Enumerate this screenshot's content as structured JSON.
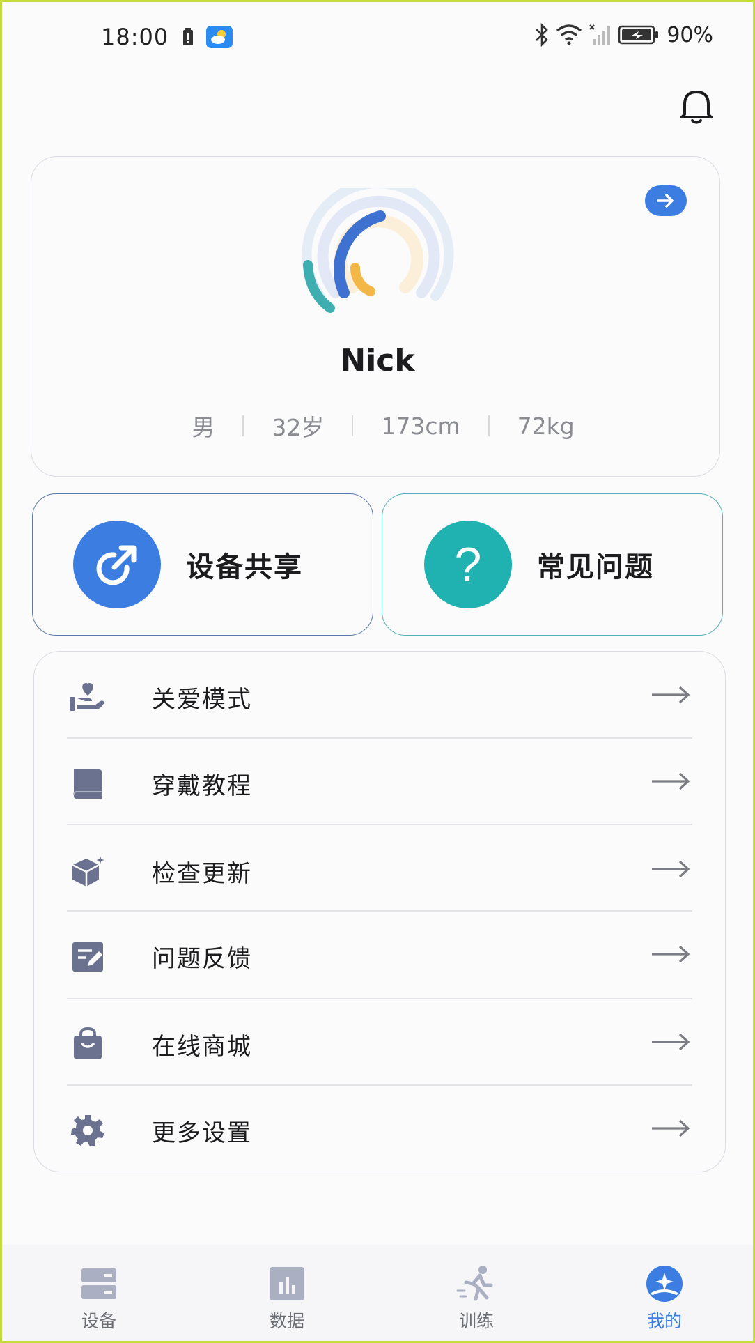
{
  "status_bar": {
    "time": "18:00",
    "battery": "90%"
  },
  "profile": {
    "name": "Nick",
    "stats": [
      "男",
      "32岁",
      "173cm",
      "72kg"
    ]
  },
  "features": {
    "share_label": "设备共享",
    "faq_label": "常见问题",
    "faq_glyph": "?"
  },
  "menu": {
    "items": [
      {
        "label": "关爱模式",
        "icon": "care-hand-heart-icon"
      },
      {
        "label": "穿戴教程",
        "icon": "book-icon"
      },
      {
        "label": "检查更新",
        "icon": "update-box-icon"
      },
      {
        "label": "问题反馈",
        "icon": "feedback-edit-icon"
      },
      {
        "label": "在线商城",
        "icon": "shopping-bag-icon"
      },
      {
        "label": "更多设置",
        "icon": "gear-icon"
      }
    ]
  },
  "bottom_nav": {
    "items": [
      {
        "label": "设备",
        "icon": "device-icon"
      },
      {
        "label": "数据",
        "icon": "data-chart-icon"
      },
      {
        "label": "训练",
        "icon": "running-icon"
      },
      {
        "label": "我的",
        "icon": "profile-icon",
        "active": true
      }
    ]
  },
  "colors": {
    "accent_blue": "#3b7de0",
    "accent_teal": "#1fb2b0",
    "icon_gray": "#6b7290",
    "frame_edge": "#c6dc3c"
  }
}
